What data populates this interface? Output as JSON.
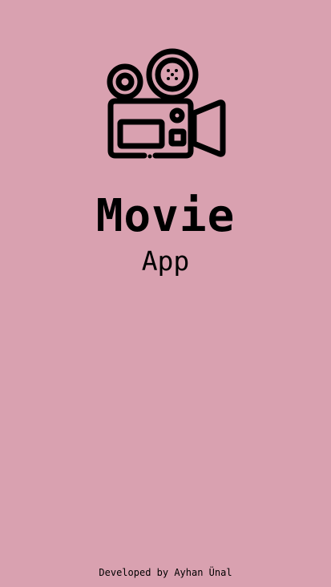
{
  "app": {
    "title": "Movie",
    "subtitle": "App",
    "credit": "Developed by Ayhan Ünal",
    "logo_icon": "movie-camera-icon"
  },
  "colors": {
    "background": "#d9a1b0",
    "foreground": "#000000"
  }
}
